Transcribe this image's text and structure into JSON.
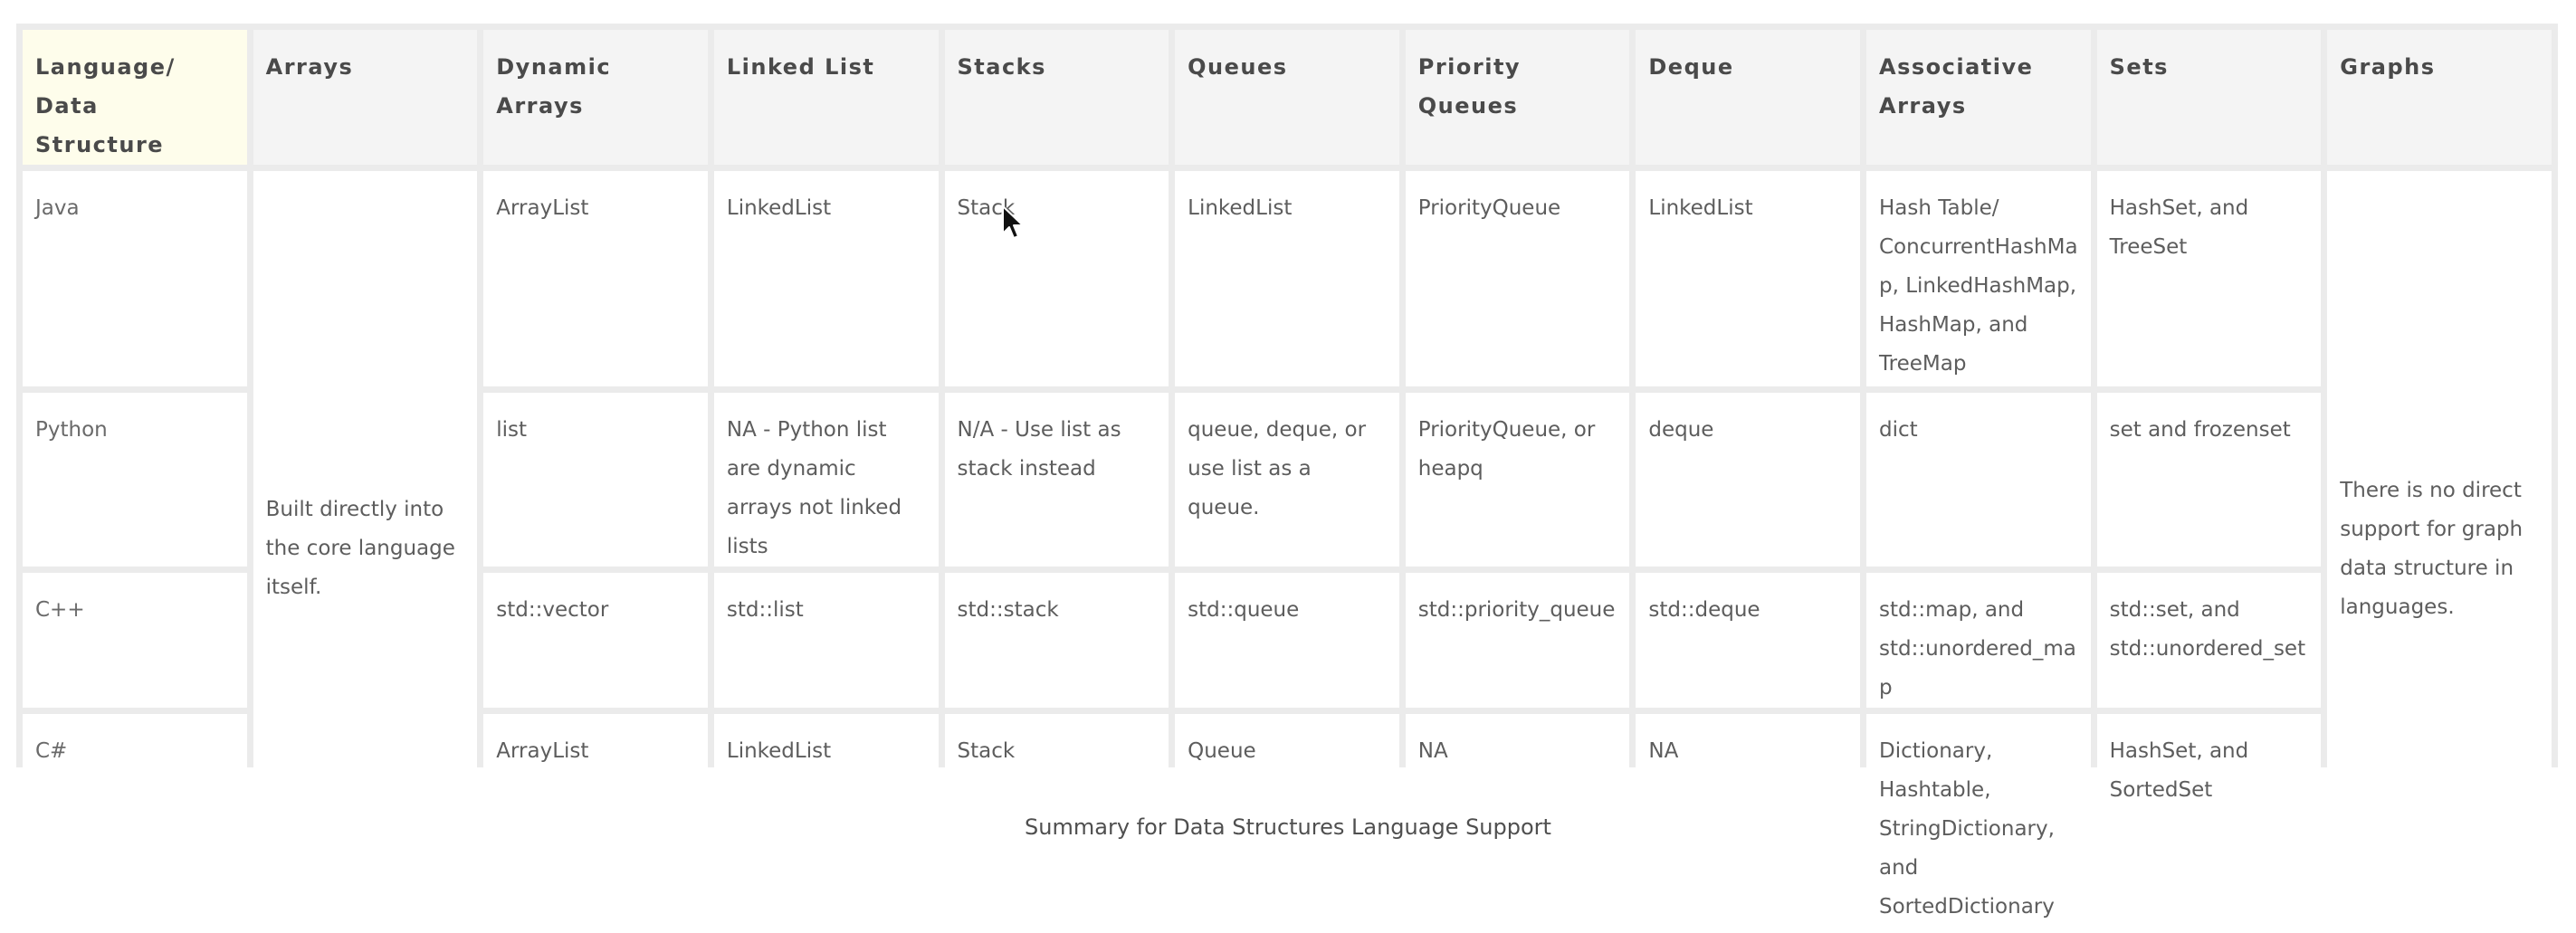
{
  "table": {
    "headers": [
      "Language/ Data Structure",
      "Arrays",
      "Dynamic Arrays",
      "Linked List",
      "Stacks",
      "Queues",
      "Priority Queues",
      "Deque",
      "Associative Arrays",
      "Sets",
      "Graphs"
    ],
    "arrays_note": "Built directly into the core language itself.",
    "graphs_note": "There is no direct support for graph data structure in languages.",
    "rows": [
      {
        "language": "Java",
        "dynamic_arrays": "ArrayList",
        "linked_list": "LinkedList",
        "stacks": "Stack",
        "queues": "LinkedList",
        "priority_queues": "PriorityQueue",
        "deque": "LinkedList",
        "associative_arrays": "Hash Table/ ConcurrentHashMap, LinkedHashMap, HashMap, and TreeMap",
        "sets": "HashSet, and TreeSet"
      },
      {
        "language": "Python",
        "dynamic_arrays": "list",
        "linked_list": "NA - Python list are dynamic arrays not linked lists",
        "stacks": "N/A - Use list as stack instead",
        "queues": "queue, deque, or use list as a queue.",
        "priority_queues": "PriorityQueue, or heapq",
        "deque": "deque",
        "associative_arrays": "dict",
        "sets": "set and frozenset"
      },
      {
        "language": "C++",
        "dynamic_arrays": "std::vector",
        "linked_list": "std::list",
        "stacks": "std::stack",
        "queues": "std::queue",
        "priority_queues": "std::priority_queue",
        "deque": "std::deque",
        "associative_arrays": "std::map, and std::unordered_map",
        "sets": "std::set, and std::unordered_set"
      },
      {
        "language": "C#",
        "dynamic_arrays": "ArrayList",
        "linked_list": "LinkedList",
        "stacks": "Stack",
        "queues": "Queue",
        "priority_queues": "NA",
        "deque": "NA",
        "associative_arrays": "Dictionary, Hashtable, StringDictionary, and SortedDictionary",
        "sets": "HashSet, and SortedSet"
      }
    ]
  },
  "caption": "Summary for Data Structures Language Support",
  "colors": {
    "grid": "#ebebeb",
    "header_bg": "#f4f4f4",
    "corner_bg": "#fefdeb",
    "cell_bg": "#ffffff",
    "text": "#5d5d5d"
  }
}
